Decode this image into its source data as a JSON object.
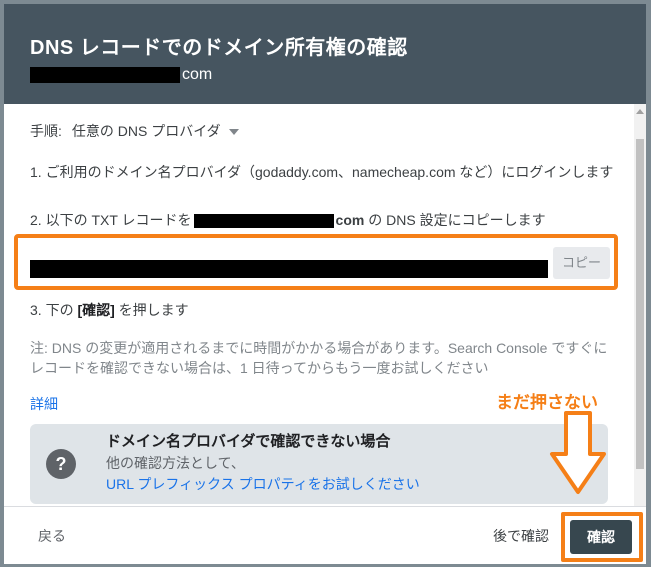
{
  "dialog": {
    "title": "DNS レコードでのドメイン所有権の確認",
    "domain_suffix": "com"
  },
  "method": {
    "label": "手順:",
    "value": "任意の DNS プロバイダ"
  },
  "steps": {
    "step1": "1. ご利用のドメイン名プロバイダ（godaddy.com、namecheap.com など）にログインします",
    "step2_prefix": "2. 以下の TXT レコードを",
    "step2_domain_bold": "com",
    "step2_suffix": " の DNS 設定にコピーします",
    "step3_prefix": "3. 下の ",
    "step3_bold": "[確認]",
    "step3_suffix": " を押します"
  },
  "copy_button": "コピー",
  "note": "注: DNS の変更が適用されるまでに時間がかかる場合があります。Search Console ですぐにレコードを確認できない場合は、1 日待ってからもう一度お試しください",
  "details_link": "詳細",
  "help_card": {
    "title": "ドメイン名プロバイダで確認できない場合",
    "text": "他の確認方法として、",
    "link": "URL プレフィックス プロパティをお試しください",
    "icon": "help-circle-icon"
  },
  "footer": {
    "back": "戻る",
    "later": "後で確認",
    "verify": "確認"
  },
  "annotation": {
    "text": "まだ押さない",
    "color": "#f57f17"
  },
  "colors": {
    "header": "#465560",
    "link": "#1a73e8",
    "primary_button": "#37474f",
    "highlight": "#f57f17"
  }
}
